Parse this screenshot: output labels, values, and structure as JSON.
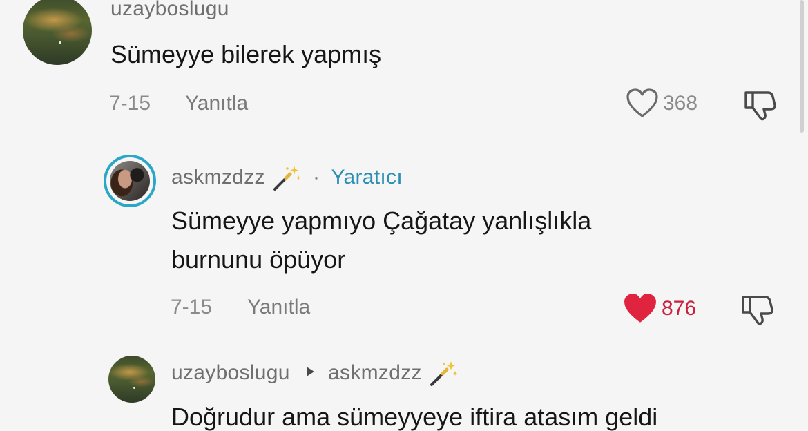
{
  "comments": [
    {
      "username": "uzayboslugu",
      "text": "Sümeyye bilerek yapmış",
      "date": "7-15",
      "reply_label": "Yanıtla",
      "like_count": "368",
      "liked": false
    },
    {
      "username": "askmzdzz",
      "separator": "·",
      "badge": "Yaratıcı",
      "text_lines": [
        "Sümeyye yapmıyo Çağatay yanlışlıkla",
        "burnunu öpüyor"
      ],
      "date": "7-15",
      "reply_label": "Yanıtla",
      "like_count": "876",
      "liked": true
    },
    {
      "username": "uzayboslugu",
      "reply_to": "askmzdzz",
      "text": "Doğrudur ama sümeyyeye iftira atasım geldi"
    }
  ],
  "colors": {
    "creator_ring": "#2aa6c7",
    "creator_label": "#2b8fb3",
    "liked_heart": "#e0243f",
    "liked_count": "#c8203d"
  },
  "icons": {
    "like": "heart-outline-icon",
    "liked": "heart-filled-icon",
    "dislike": "thumbs-down-icon",
    "creator_flair": "magic-wand-icon",
    "reply_arrow": "caret-right-icon"
  }
}
